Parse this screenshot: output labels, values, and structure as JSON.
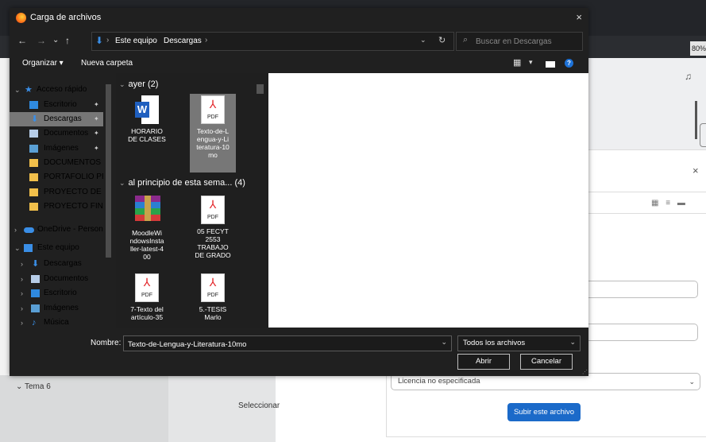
{
  "background": {
    "zoom": "80%",
    "left_section": "Tema 6",
    "left_action": "Seleccionar",
    "license_select": "Licencia no especificada",
    "upload_button": "Subir este archivo",
    "close_glyph": "×",
    "view_icons": "▦ ≡ ▬",
    "bell_glyph": "♫"
  },
  "dialog": {
    "title": "Carga de archivos",
    "close_glyph": "×",
    "nav": {
      "back": "←",
      "forward": "→",
      "recent": "⌄",
      "up": "↑"
    },
    "address": {
      "crumbs": [
        "Este equipo",
        "Descargas"
      ],
      "sep": "›",
      "drop": "⌄",
      "refresh": "↻"
    },
    "search": {
      "icon": "⌕",
      "placeholder": "Buscar en Descargas"
    },
    "toolbar": {
      "organize": "Organizar ▾",
      "new_folder": "Nueva carpeta",
      "view_glyph": "▦",
      "view_drop": "▾",
      "help": "?"
    },
    "nav_pane": [
      {
        "label": "Acceso rápido",
        "chev": "⌄",
        "icon": "★"
      },
      {
        "label": "Escritorio",
        "pin": "✦"
      },
      {
        "label": "Descargas",
        "pin": "✦",
        "selected": true
      },
      {
        "label": "Documentos",
        "pin": "✦"
      },
      {
        "label": "Imágenes",
        "pin": "✦"
      },
      {
        "label": "DOCUMENTOS DE"
      },
      {
        "label": "PORTAFOLIO PRO"
      },
      {
        "label": "PROYECTO DE TITU"
      },
      {
        "label": "PROYECTO FINAL"
      },
      {
        "label": "OneDrive - Persona",
        "chev": "›"
      },
      {
        "label": "Este equipo",
        "chev": "⌄"
      },
      {
        "label": "Descargas",
        "chev": "›"
      },
      {
        "label": "Documentos",
        "chev": "›"
      },
      {
        "label": "Escritorio",
        "chev": "›"
      },
      {
        "label": "Imágenes",
        "chev": "›"
      },
      {
        "label": "Música",
        "chev": "›"
      }
    ],
    "groups": [
      {
        "label": "ayer (2)",
        "chev": "⌄"
      },
      {
        "label": "al principio de esta sema... (4)",
        "chev": "⌄"
      }
    ],
    "files": [
      {
        "name": "HORARIO DE CLASES",
        "type": "word"
      },
      {
        "name": "Texto-de-Lengua-y-Literatura-10mo",
        "type": "pdf",
        "selected": true
      },
      {
        "name": "MoodleWindowsInstaller-latest-400",
        "type": "rar"
      },
      {
        "name": "05 FECYT 2553 TRABAJO DE GRADO",
        "type": "pdf"
      },
      {
        "name": "7-Texto del artículo-35",
        "type": "pdf"
      },
      {
        "name": "5.-TESIS Marlo",
        "type": "pdf"
      }
    ],
    "file_display": [
      "HORARIO\nDE CLASES",
      "Texto-de-L\nengua-y-Li\nteratura-10\nmo",
      "MoodleWi\nndowsInsta\nller-latest-4\n00",
      "05 FECYT\n2553\nTRABAJO\nDE GRADO",
      "7-Texto del\nartículo-35",
      "5.-TESIS\nMarlo"
    ],
    "pdf_label": "PDF",
    "pdf_symbol": "⅄",
    "word_letter": "W",
    "filename_label": "Nombre:",
    "filename_value": "Texto-de-Lengua-y-Literatura-10mo",
    "filetype_value": "Todos los archivos",
    "drop_glyph": "⌄",
    "open_button": "Abrir",
    "cancel_button": "Cancelar"
  }
}
